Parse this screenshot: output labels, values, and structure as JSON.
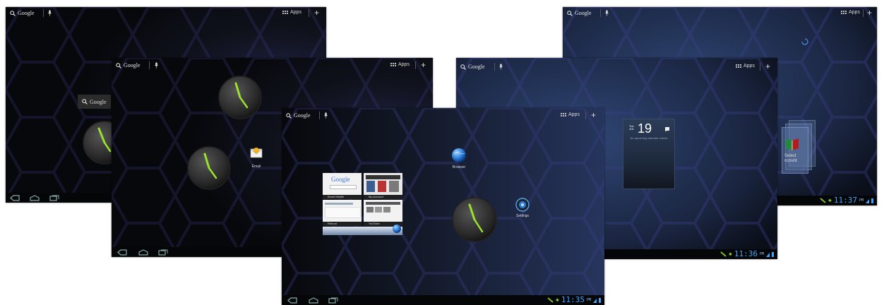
{
  "homescreen": {
    "search_label": "Google",
    "apps_label": "Apps"
  },
  "widgets": {
    "email_label": "Email",
    "browser_label": "Browser",
    "settings_label": "Settings"
  },
  "bookmarks": {
    "items": [
      {
        "label": "Boost Mobile",
        "preview_title": "Google"
      },
      {
        "label": "My Account"
      },
      {
        "label": "Reboot"
      },
      {
        "label": "YouTube"
      }
    ]
  },
  "calendar": {
    "day_abbrev": "Tue",
    "month_abbrev": "JUL",
    "date": "19",
    "note": "No upcoming calendar events"
  },
  "account": {
    "line1": "Select",
    "line2": "ccount"
  },
  "status": {
    "time_center": "11:35",
    "time_mid": "11:36",
    "time_back": "11:37",
    "ampm": "PM"
  },
  "colors": {
    "clock_hands": "#9be22d",
    "clock_time_blue": "#3fa5ff",
    "wallpaper_dark": "#0b0d12",
    "wallpaper_blue": "#2a3b66"
  }
}
